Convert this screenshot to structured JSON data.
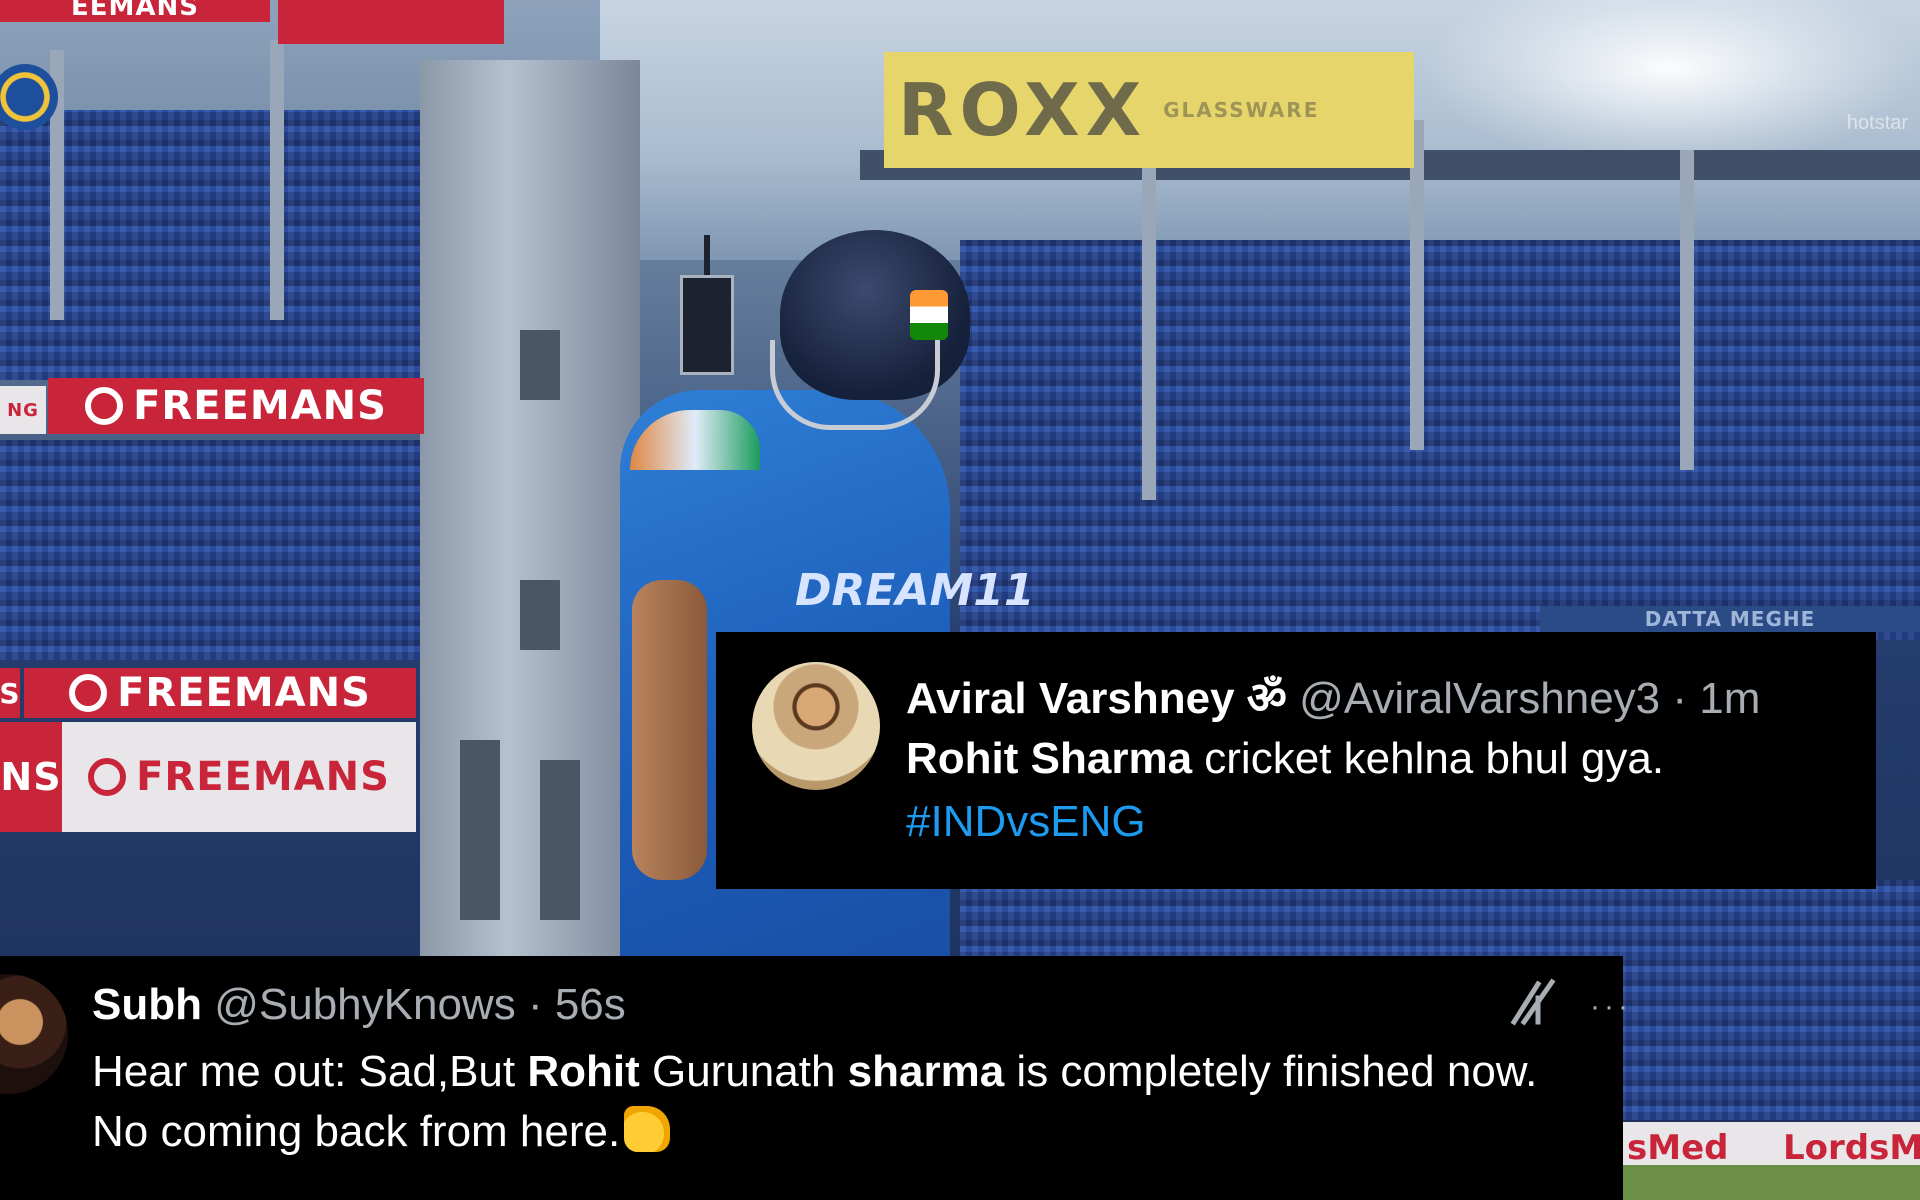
{
  "background": {
    "ads": {
      "freemans_1": "FREEMANS",
      "freemans_2": "FREEMANS",
      "freemans_3": "FREEMANS",
      "freemans_top": "EEMANS",
      "roxx": "ROXX",
      "roxx_sub": "GLASSWARE",
      "side_ng": "NG",
      "side_s": "S",
      "side_ns": "NS",
      "datta_meghe": "DATTA MEGHE",
      "field_left": "sMed",
      "field_right": "LordsM"
    },
    "jersey_text": "DREAM11",
    "broadcaster_watermark": "hotstar"
  },
  "tweets": {
    "top": {
      "display_name": "Aviral Varshney ॐ",
      "handle": "@AviralVarshney3",
      "time": "· 1m",
      "text_bold": "Rohit Sharma",
      "text_rest": " cricket kehlna bhul gya.",
      "hashtag": "#INDvsENG"
    },
    "bottom": {
      "display_name": "Subh",
      "handle": "@SubhyKnows",
      "time": "· 56s",
      "text_part1": "Hear me out: Sad,But ",
      "text_bold1": "Rohit",
      "text_part2": " Gurunath ",
      "text_bold2": "sharma",
      "text_part3": " is completely finished now.",
      "line2": "No coming back from here.",
      "more": "···"
    }
  },
  "colors": {
    "tweet_bg": "#000000",
    "hashtag": "#1d9bf0",
    "meta_text": "#a8adb3",
    "ad_red": "#c9253a",
    "jersey_blue": "#1b5bb8"
  },
  "icons": {
    "grok": "grok-slash-icon",
    "more": "more-dots-icon",
    "bcci_logo": "bcci-logo"
  }
}
